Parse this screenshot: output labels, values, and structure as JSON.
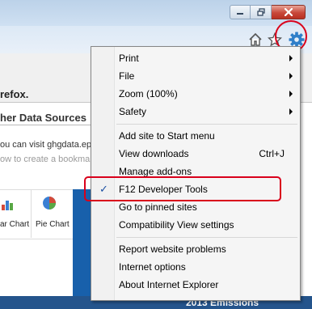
{
  "page": {
    "firefox_text": "refox.",
    "data_sources_tab": "her Data Sources",
    "visit_text": "ou can visit ghgdata.epa",
    "howto_text": "ow to create a bookman",
    "bar_chart_label": "ar Chart",
    "pie_chart_label": "Pie Chart",
    "emissions_label": "2013 Emissions"
  },
  "menu": {
    "items": [
      {
        "label": "Print",
        "submenu": true
      },
      {
        "label": "File",
        "submenu": true
      },
      {
        "label": "Zoom (100%)",
        "submenu": true
      },
      {
        "label": "Safety",
        "submenu": true
      },
      {
        "label": "Add site to Start menu"
      },
      {
        "label": "View downloads",
        "shortcut": "Ctrl+J"
      },
      {
        "label": "Manage add-ons"
      },
      {
        "label": "F12 Developer Tools",
        "checked": true
      },
      {
        "label": "Go to pinned sites"
      },
      {
        "label": "Compatibility View settings"
      },
      {
        "label": "Report website problems"
      },
      {
        "label": "Internet options"
      },
      {
        "label": "About Internet Explorer"
      }
    ]
  },
  "colors": {
    "annotation_red": "#d9001b",
    "check_blue": "#1b4fa3"
  },
  "icons": [
    "minimize-icon",
    "maximize-icon",
    "close-icon",
    "home-icon",
    "favorites-star-icon",
    "tools-gear-icon",
    "checkmark-icon",
    "submenu-arrow-icon"
  ]
}
